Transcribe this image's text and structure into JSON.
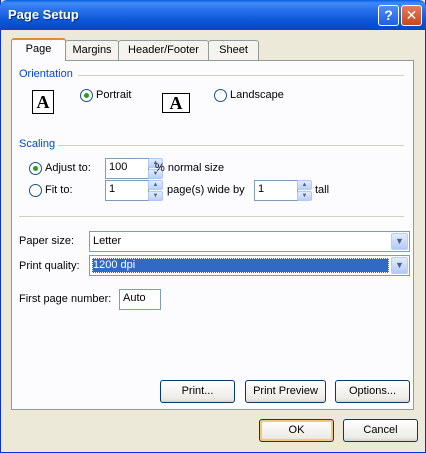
{
  "title": "Page Setup",
  "titlebar": {
    "help_glyph": "?",
    "close_glyph": "✕"
  },
  "tabs": [
    {
      "label": "Page",
      "active": true
    },
    {
      "label": "Margins",
      "active": false
    },
    {
      "label": "Header/Footer",
      "active": false
    },
    {
      "label": "Sheet",
      "active": false
    }
  ],
  "orientation": {
    "label": "Orientation",
    "portrait_label": "Portrait",
    "landscape_label": "Landscape",
    "selected": "portrait",
    "icon_glyph": "A"
  },
  "scaling": {
    "label": "Scaling",
    "adjust_label": "Adjust to:",
    "adjust_value": "100",
    "adjust_suffix": "% normal size",
    "fit_label": "Fit to:",
    "fit_wide_value": "1",
    "fit_wide_suffix": "page(s) wide by",
    "fit_tall_value": "1",
    "fit_tall_suffix": "tall",
    "selected": "adjust"
  },
  "paper_size": {
    "label": "Paper size:",
    "value": "Letter"
  },
  "print_quality": {
    "label": "Print quality:",
    "value": "1200 dpi"
  },
  "first_page": {
    "label": "First page number:",
    "value": "Auto"
  },
  "buttons": {
    "print": "Print...",
    "print_preview": "Print Preview",
    "options": "Options...",
    "ok": "OK",
    "cancel": "Cancel"
  },
  "colors": {
    "titlebar": "#0a56d8",
    "section_label": "#0046d5",
    "radio_dot": "#21a121",
    "selection": "#316ac5"
  }
}
